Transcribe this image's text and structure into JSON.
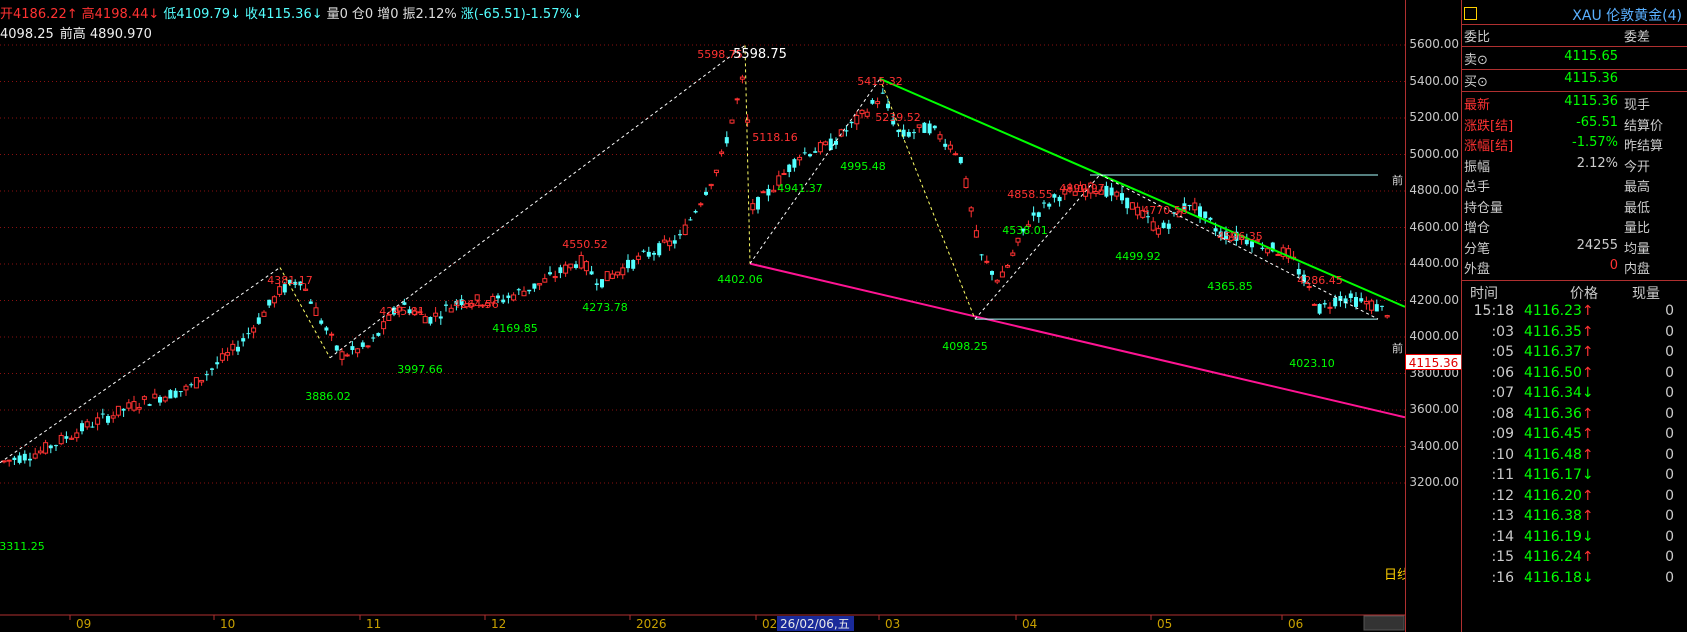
{
  "header": {
    "open": "开4186.22↑",
    "high": "高4198.44↓",
    "low": "低4109.79↓",
    "close": "收4115.36↓",
    "volume": "量0",
    "position": "仓0",
    "increase": "增0",
    "amplitude": "振2.12%",
    "change": "涨(-65.51)-1.57%↓",
    "line2_value": "4098.25",
    "line2_prev_high": "前高 4890.970"
  },
  "colors": {
    "up": "#ff3232",
    "down": "#54ffff",
    "green": "#00ff00",
    "magenta": "#ff1493",
    "yellow": "#ffff66"
  },
  "chart_data": {
    "type": "candlestick",
    "ylim": [
      3200,
      5700
    ],
    "y_ticks": [
      "5600.00",
      "5400.00",
      "5200.00",
      "5000.00",
      "4800.00",
      "4600.00",
      "4400.00",
      "4200.00",
      "4000.00",
      "3800.00",
      "3600.00",
      "3400.00",
      "3200.00"
    ],
    "x_labels": [
      "09",
      "10",
      "11",
      "12",
      "2026",
      "02",
      "03",
      "04",
      "05",
      "06"
    ],
    "x_highlight": "26/02/06,五",
    "bottom_right_label": "日线",
    "last_price": "4115.36",
    "annotations": [
      {
        "text": "5598.75",
        "kind": "high"
      },
      {
        "text": "5598.75",
        "kind": "peak-white"
      },
      {
        "text": "5415.32",
        "kind": "high"
      },
      {
        "text": "5239.52",
        "kind": "high"
      },
      {
        "text": "5118.16",
        "kind": "high"
      },
      {
        "text": "4995.48",
        "kind": "low"
      },
      {
        "text": "4941.37",
        "kind": "low"
      },
      {
        "text": "4858.55",
        "kind": "high"
      },
      {
        "text": "4890.97",
        "kind": "high"
      },
      {
        "text": "4770.58",
        "kind": "high"
      },
      {
        "text": "4596.35",
        "kind": "high"
      },
      {
        "text": "4550.52",
        "kind": "high"
      },
      {
        "text": "4381.17",
        "kind": "high"
      },
      {
        "text": "4286.45",
        "kind": "high"
      },
      {
        "text": "4264.56",
        "kind": "high"
      },
      {
        "text": "4245.81",
        "kind": "high"
      },
      {
        "text": "4538.01",
        "kind": "low"
      },
      {
        "text": "4499.92",
        "kind": "low"
      },
      {
        "text": "4402.06",
        "kind": "low"
      },
      {
        "text": "4365.85",
        "kind": "low"
      },
      {
        "text": "4273.78",
        "kind": "low"
      },
      {
        "text": "4169.85",
        "kind": "low"
      },
      {
        "text": "4098.25",
        "kind": "low"
      },
      {
        "text": "4023.10",
        "kind": "low"
      },
      {
        "text": "3997.66",
        "kind": "low"
      },
      {
        "text": "3886.02",
        "kind": "low"
      },
      {
        "text": "3311.25",
        "kind": "low"
      }
    ],
    "front_labels": [
      "前",
      "前"
    ]
  },
  "panel": {
    "title": "XAU 伦敦黄金(4)",
    "header_left": "委比",
    "header_right": "委差",
    "sell_label": "卖⊙",
    "sell_value": "4115.65",
    "buy_label": "买⊙",
    "buy_value": "4115.36",
    "stats": [
      {
        "label": "最新",
        "value": "4115.36",
        "right": "现手"
      },
      {
        "label": "涨跌[结]",
        "value": "-65.51",
        "right": "结算价"
      },
      {
        "label": "涨幅[结]",
        "value": "-1.57%",
        "right": "昨结算"
      },
      {
        "label": "振幅",
        "value": "2.12%",
        "right": "今开"
      },
      {
        "label": "总手",
        "value": "",
        "right": "最高"
      },
      {
        "label": "持仓量",
        "value": "",
        "right": "最低"
      },
      {
        "label": "增仓",
        "value": "",
        "right": "量比"
      },
      {
        "label": "分笔",
        "value": "24255",
        "right": "均量"
      },
      {
        "label": "外盘",
        "value": "0",
        "right": "内盘"
      }
    ],
    "ticks_header": {
      "time": "时间",
      "price": "价格",
      "vol": "现量"
    },
    "ticks": [
      {
        "time": "15:18",
        "price": "4116.23↑",
        "vol": "0"
      },
      {
        "time": ":03",
        "price": "4116.35↑",
        "vol": "0"
      },
      {
        "time": ":05",
        "price": "4116.37↑",
        "vol": "0"
      },
      {
        "time": ":06",
        "price": "4116.50↑",
        "vol": "0"
      },
      {
        "time": ":07",
        "price": "4116.34↓",
        "vol": "0"
      },
      {
        "time": ":08",
        "price": "4116.36↑",
        "vol": "0"
      },
      {
        "time": ":09",
        "price": "4116.45↑",
        "vol": "0"
      },
      {
        "time": ":10",
        "price": "4116.48↑",
        "vol": "0"
      },
      {
        "time": ":11",
        "price": "4116.17↓",
        "vol": "0"
      },
      {
        "time": ":12",
        "price": "4116.20↑",
        "vol": "0"
      },
      {
        "time": ":13",
        "price": "4116.38↑",
        "vol": "0"
      },
      {
        "time": ":14",
        "price": "4116.19↓",
        "vol": "0"
      },
      {
        "time": ":15",
        "price": "4116.24↑",
        "vol": "0"
      },
      {
        "time": ":16",
        "price": "4116.18↓",
        "vol": "0"
      }
    ]
  }
}
